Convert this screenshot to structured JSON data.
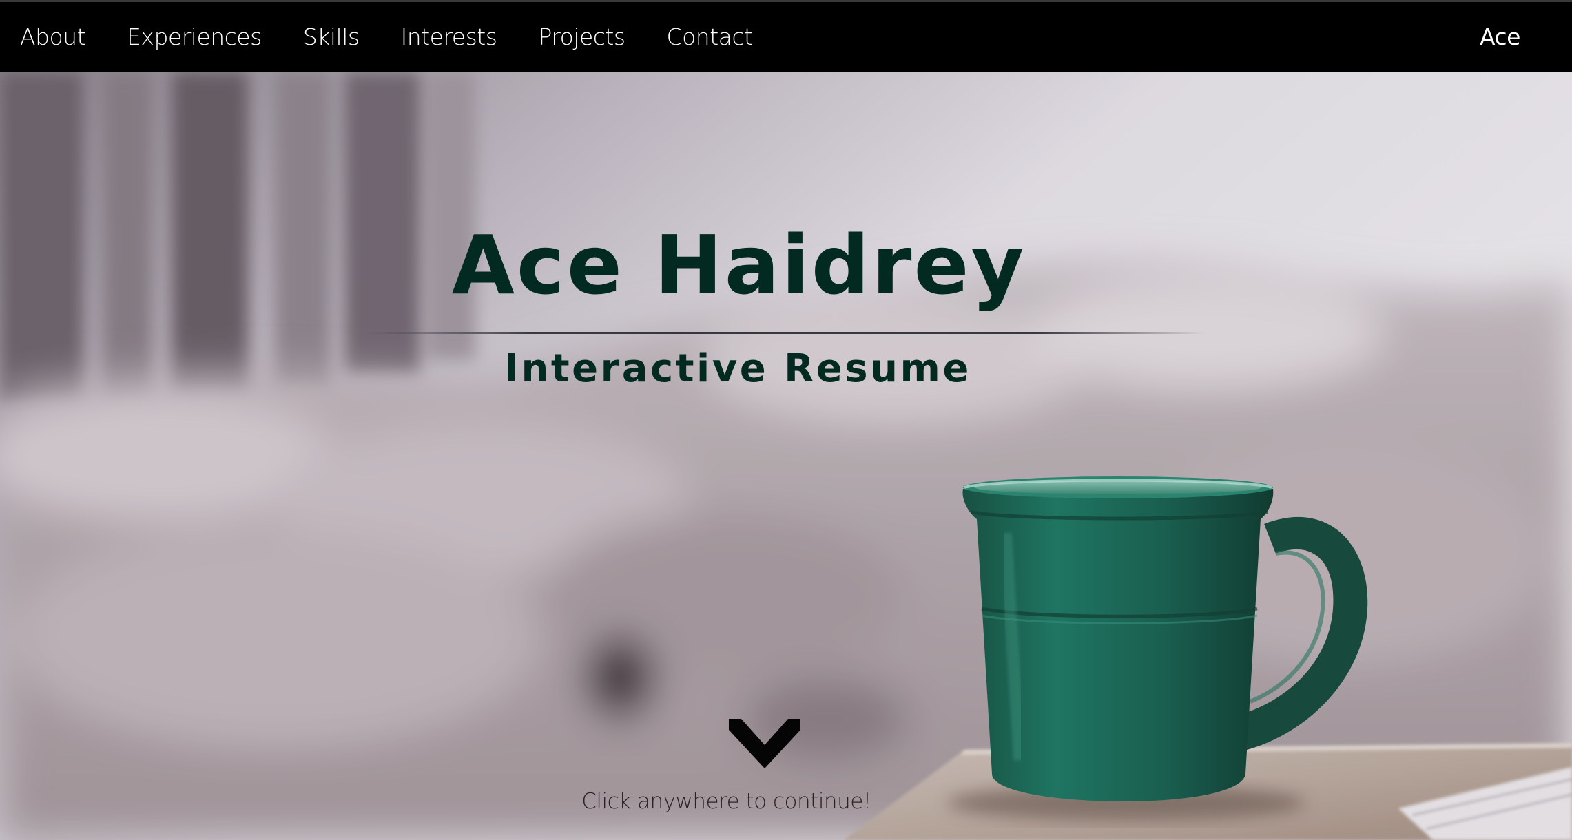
{
  "nav": {
    "links": [
      {
        "label": "About"
      },
      {
        "label": "Experiences"
      },
      {
        "label": "Skills"
      },
      {
        "label": "Interests"
      },
      {
        "label": "Projects"
      },
      {
        "label": "Contact"
      }
    ],
    "brand": "Ace"
  },
  "hero": {
    "title": "Ace Haidrey",
    "subtitle": "Interactive Resume",
    "continue_text": "Click anywhere to continue!",
    "scroll_icon": "chevron-down-icon",
    "background_image": "coffee mug on bedside table with blurred bed",
    "colors": {
      "heading": "#032a20",
      "navbar": "#000000",
      "nav_text": "#ffffff",
      "mug": "#1f6b5a"
    }
  }
}
